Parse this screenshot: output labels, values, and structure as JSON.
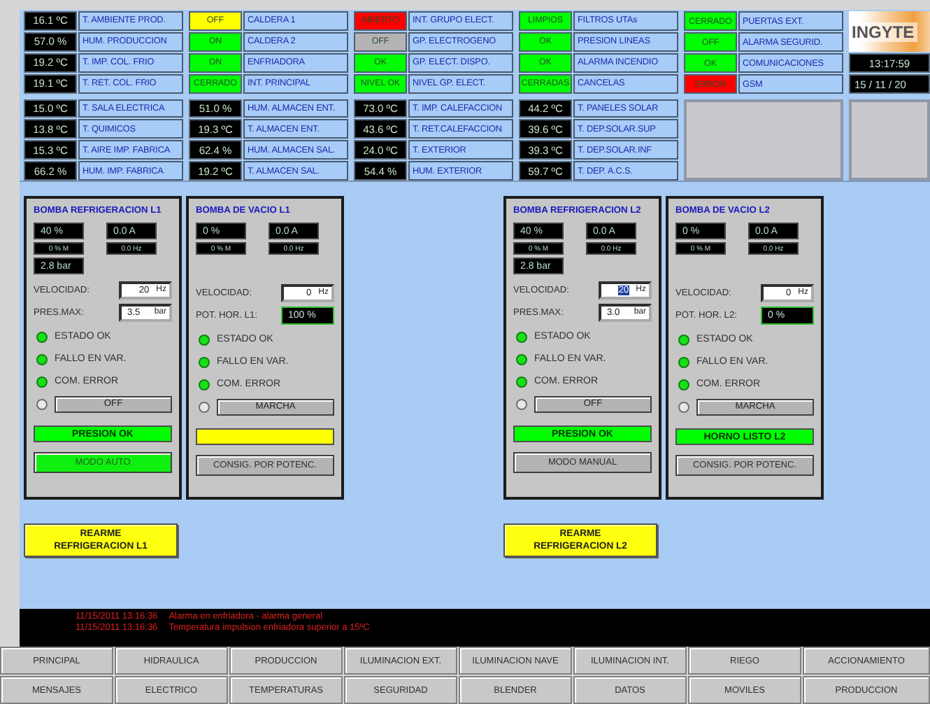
{
  "indicators": [
    {
      "rows": [
        {
          "kind": "value",
          "value": "16.1 ºC",
          "label": "T. AMBIENTE PROD."
        },
        {
          "kind": "value",
          "value": "57.0 %",
          "label": "HUM. PRODUCCION"
        },
        {
          "kind": "value",
          "value": "19.2 ºC",
          "label": "T. IMP. COL. FRIO"
        },
        {
          "kind": "value",
          "value": "19.1 ºC",
          "label": "T. RET. COL. FRIO"
        },
        {
          "kind": "value",
          "value": "15.0 ºC",
          "label": "T. SALA ELECTRICA"
        },
        {
          "kind": "value",
          "value": "13.8 ºC",
          "label": "T. QUIMICOS"
        },
        {
          "kind": "value",
          "value": "15.3 ºC",
          "label": "T. AIRE IMP. FABRICA"
        },
        {
          "kind": "value",
          "value": "66.2 %",
          "label": "HUM. IMP. FABRICA"
        }
      ]
    },
    {
      "rows": [
        {
          "kind": "status",
          "value": "OFF",
          "color": "#ffff00",
          "label": "CALDERA 1"
        },
        {
          "kind": "status",
          "value": "ON",
          "color": "#00ff00",
          "label": "CALDERA 2"
        },
        {
          "kind": "status",
          "value": "ON",
          "color": "#00ff00",
          "label": "ENFRIADORA"
        },
        {
          "kind": "status",
          "value": "CERRADO",
          "color": "#00ff00",
          "label": "INT. PRINCIPAL"
        },
        {
          "kind": "value",
          "value": "51.0 %",
          "label": "HUM. ALMACEN ENT."
        },
        {
          "kind": "value",
          "value": "19.3 ºC",
          "label": "T. ALMACEN ENT."
        },
        {
          "kind": "value",
          "value": "62.4 %",
          "label": "HUM. ALMACEN SAL."
        },
        {
          "kind": "value",
          "value": "19.2 ºC",
          "label": "T. ALMACEN SAL."
        }
      ]
    },
    {
      "rows": [
        {
          "kind": "status",
          "value": "ABIERTO",
          "color": "#ff0000",
          "label": "INT. GRUPO ELECT."
        },
        {
          "kind": "status",
          "value": "OFF",
          "color": "#b4b4b4",
          "label": "GP. ELECTROGENO"
        },
        {
          "kind": "status",
          "value": "OK",
          "color": "#00ff00",
          "label": "GP. ELECT. DISPO."
        },
        {
          "kind": "status",
          "value": "NIVEL OK",
          "color": "#00ff00",
          "label": "NIVEL GP. ELECT."
        },
        {
          "kind": "value",
          "value": "73.0 ºC",
          "label": "T. IMP. CALEFACCION"
        },
        {
          "kind": "value",
          "value": "43.6 ºC",
          "label": "T. RET.CALEFACCION"
        },
        {
          "kind": "value",
          "value": "24.0 ºC",
          "label": "T. EXTERIOR"
        },
        {
          "kind": "value",
          "value": "54.4 %",
          "label": "HUM. EXTERIOR"
        }
      ]
    },
    {
      "rows": [
        {
          "kind": "status",
          "value": "LIMPIOS",
          "color": "#00ff00",
          "label": "FILTROS UTAs"
        },
        {
          "kind": "status",
          "value": "OK",
          "color": "#00ff00",
          "label": "PRESION LINEAS"
        },
        {
          "kind": "status",
          "value": "OK",
          "color": "#00ff00",
          "label": "ALARMA INCENDIO"
        },
        {
          "kind": "status",
          "value": "CERRADAS",
          "color": "#00ff00",
          "label": "CANCELAS"
        },
        {
          "kind": "value",
          "value": "44.2 ºC",
          "label": "T. PANELES SOLAR"
        },
        {
          "kind": "value",
          "value": "39.6 ºC",
          "label": "T. DEP.SOLAR.SUP"
        },
        {
          "kind": "value",
          "value": "39.3 ºC",
          "label": "T. DEP.SOLAR.INF"
        },
        {
          "kind": "value",
          "value": "59.7 ºC",
          "label": "T. DEP. A.C.S."
        }
      ]
    },
    {
      "rows": [
        {
          "kind": "status",
          "value": "CERRADO",
          "color": "#00ff00",
          "label": "PUERTAS EXT."
        },
        {
          "kind": "status",
          "value": "OFF",
          "color": "#00ff00",
          "label": "ALARMA SEGURID."
        },
        {
          "kind": "status",
          "value": "OK",
          "color": "#00ff00",
          "label": "COMUNICACIONES"
        },
        {
          "kind": "status",
          "value": "ERROR",
          "color": "#ff0000",
          "label": "GSM"
        }
      ]
    }
  ],
  "logo": {
    "text": "INGYTE"
  },
  "clock": {
    "time": "13:17:59",
    "date": "15 / 11 / 20"
  },
  "lines": [
    {
      "pumps": [
        {
          "title": "BOMBA REFRIGERACION L1",
          "readings": [
            {
              "kind": "main",
              "value": "40 %"
            },
            {
              "kind": "main",
              "value": "0.0 A"
            },
            {
              "kind": "sub",
              "value": "0 % M"
            },
            {
              "kind": "sub",
              "value": "0.0 Hz"
            },
            {
              "kind": "main",
              "value": "2.8 bar"
            }
          ],
          "fields": [
            {
              "kind": "input",
              "label": "VELOCIDAD:",
              "value": "20",
              "unit": "Hz",
              "selected": false
            },
            {
              "kind": "input",
              "label": "PRES.MAX:",
              "value": "3.5",
              "unit": "bar",
              "selected": false
            }
          ],
          "leds": [
            {
              "label": "ESTADO OK",
              "on": true
            },
            {
              "label": "FALLO EN VAR.",
              "on": true
            },
            {
              "label": "COM. ERROR",
              "on": true
            }
          ],
          "command": {
            "on": false,
            "label": "OFF"
          },
          "status": {
            "text": "PRESION OK",
            "color": "#00ff00"
          },
          "mode_button": {
            "label": "MODO AUTO",
            "active": true
          }
        },
        {
          "title": "BOMBA DE VACIO L1",
          "readings": [
            {
              "kind": "main",
              "value": "0 %"
            },
            {
              "kind": "main",
              "value": "0.0 A"
            },
            {
              "kind": "sub",
              "value": "0 % M"
            },
            {
              "kind": "sub",
              "value": "0.0 Hz"
            }
          ],
          "fields": [
            {
              "kind": "input",
              "label": "VELOCIDAD:",
              "value": "0",
              "unit": "Hz",
              "selected": false
            },
            {
              "kind": "display",
              "label": "POT. HOR. L1:",
              "value": "100 %",
              "selected": false
            }
          ],
          "leds": [
            {
              "label": "ESTADO OK",
              "on": true
            },
            {
              "label": "FALLO EN VAR.",
              "on": true
            },
            {
              "label": "COM. ERROR",
              "on": true
            }
          ],
          "command": {
            "on": false,
            "label": "MARCHA"
          },
          "status": {
            "color": "#ffff00"
          },
          "mode_button": {
            "label": "CONSIG. POR POTENC.",
            "active": false
          }
        }
      ],
      "reset_button": [
        "REARME",
        "REFRIGERACION L1"
      ]
    },
    {
      "pumps": [
        {
          "title": "BOMBA REFRIGERACION L2",
          "readings": [
            {
              "kind": "main",
              "value": "40 %"
            },
            {
              "kind": "main",
              "value": "0.0 A"
            },
            {
              "kind": "sub",
              "value": "0 % M"
            },
            {
              "kind": "sub",
              "value": "0.0 Hz"
            },
            {
              "kind": "main",
              "value": "2.8 bar"
            }
          ],
          "fields": [
            {
              "kind": "input",
              "label": "VELOCIDAD:",
              "value": "20",
              "unit": "Hz",
              "selected": true
            },
            {
              "kind": "input",
              "label": "PRES.MAX:",
              "value": "3.0",
              "unit": "bar",
              "selected": false
            }
          ],
          "leds": [
            {
              "label": "ESTADO OK",
              "on": true
            },
            {
              "label": "FALLO EN VAR.",
              "on": true
            },
            {
              "label": "COM. ERROR",
              "on": true
            }
          ],
          "command": {
            "on": false,
            "label": "OFF"
          },
          "status": {
            "text": "PRESION OK",
            "color": "#00ff00"
          },
          "mode_button": {
            "label": "MODO MANUAL",
            "active": false
          }
        },
        {
          "title": "BOMBA DE VACIO L2",
          "readings": [
            {
              "kind": "main",
              "value": "0 %"
            },
            {
              "kind": "main",
              "value": "0.0 A"
            },
            {
              "kind": "sub",
              "value": "0 % M"
            },
            {
              "kind": "sub",
              "value": "0.0 Hz"
            }
          ],
          "fields": [
            {
              "kind": "input",
              "label": "VELOCIDAD:",
              "value": "0",
              "unit": "Hz",
              "selected": false
            },
            {
              "kind": "display",
              "label": "POT. HOR. L2:",
              "value": "0 %",
              "selected": false
            }
          ],
          "leds": [
            {
              "label": "ESTADO OK",
              "on": true
            },
            {
              "label": "FALLO EN VAR.",
              "on": true
            },
            {
              "label": "COM. ERROR",
              "on": true
            }
          ],
          "command": {
            "on": false,
            "label": "MARCHA"
          },
          "status": {
            "text": "HORNO LISTO L2",
            "color": "#00ff00"
          },
          "mode_button": {
            "label": "CONSIG. POR POTENC.",
            "active": false
          }
        }
      ],
      "reset_button": [
        "REARME",
        "REFRIGERACION L2"
      ]
    }
  ],
  "alarms": [
    {
      "time": "11/15/2011 13:16:36",
      "message": "Alarma en enfriadora - alarma general"
    },
    {
      "time": "11/15/2011 13:16:36",
      "message": "Temperatura impulsion enfriadora superior a 15ºC"
    }
  ],
  "nav": [
    [
      "PRINCIPAL",
      "HIDRAULICA",
      "PRODUCCION",
      "ILUMINACION EXT.",
      "ILUMINACION NAVE",
      "ILUMINACION INT.",
      "RIEGO",
      "ACCIONAMIENTO"
    ],
    [
      "MENSAJES",
      "ELECTRICO",
      "TEMPERATURAS",
      "SEGURIDAD",
      "BLENDER",
      "DATOS",
      "MOVILES",
      "PRODUCCION"
    ]
  ]
}
